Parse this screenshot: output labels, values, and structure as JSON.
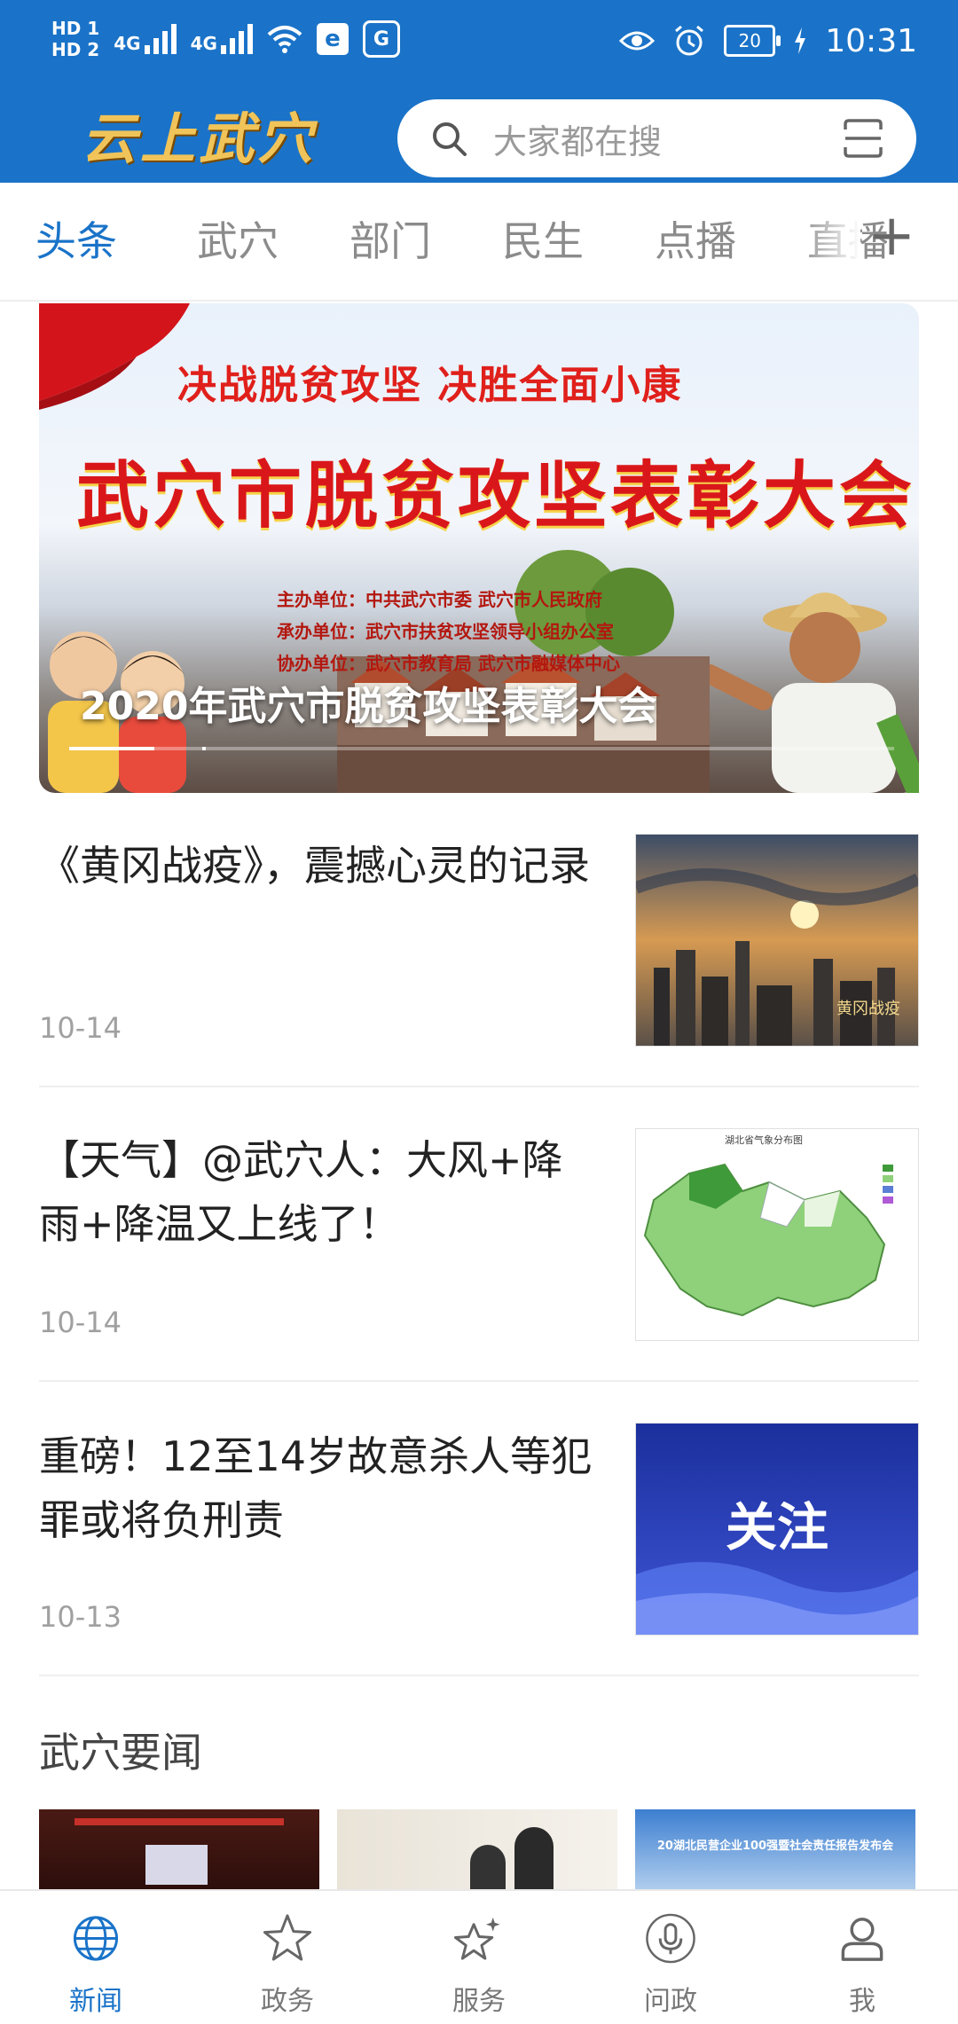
{
  "status_bar": {
    "hd1": "HD 1",
    "hd2": "HD 2",
    "net1": "4G",
    "net2": "4G",
    "battery": "20",
    "time": "10:31"
  },
  "header": {
    "logo_text": "云上武穴",
    "search_placeholder": "大家都在搜",
    "brand_color": "#1a73c8"
  },
  "tabs": [
    {
      "label": "头条",
      "active": true
    },
    {
      "label": "武穴",
      "active": false
    },
    {
      "label": "部门",
      "active": false
    },
    {
      "label": "民生",
      "active": false
    },
    {
      "label": "点播",
      "active": false
    },
    {
      "label": "直播",
      "active": false
    }
  ],
  "tab_add_label": "+",
  "banner": {
    "slogan": "决战脱贫攻坚  决胜全面小康",
    "headline": "武穴市脱贫攻坚表彰大会",
    "org_lines": [
      "主办单位：中共武穴市委   武穴市人民政府",
      "承办单位：武穴市扶贫攻坚领导小组办公室",
      "协办单位：武穴市教育局  武穴市融媒体中心"
    ],
    "caption": "2020年武穴市脱贫攻坚表彰大会"
  },
  "news": [
    {
      "title": "《黄冈战疫》，震撼心灵的记录",
      "date": "10-14",
      "thumb": "city-sunset",
      "thumb_caption": "黄冈战疫"
    },
    {
      "title": "【天气】@武穴人：大风+降雨+降温又上线了！",
      "date": "10-14",
      "thumb": "weather-map",
      "thumb_caption": "湖北省气象分布图"
    },
    {
      "title": "重磅！12至14岁故意杀人等犯罪或将负刑责",
      "date": "10-13",
      "thumb": "attention-card",
      "thumb_caption": "关注"
    }
  ],
  "section": {
    "title": "武穴要闻",
    "strip_captions": [
      "",
      "",
      "20湖北民营企业100强暨社会责任报告发布会"
    ]
  },
  "bottom_nav": [
    {
      "label": "新闻",
      "icon": "globe-icon",
      "active": true
    },
    {
      "label": "政务",
      "icon": "star-icon",
      "active": false
    },
    {
      "label": "服务",
      "icon": "sparkle-star-icon",
      "active": false
    },
    {
      "label": "问政",
      "icon": "microphone-icon",
      "active": false
    },
    {
      "label": "我",
      "icon": "person-icon",
      "active": false
    }
  ]
}
